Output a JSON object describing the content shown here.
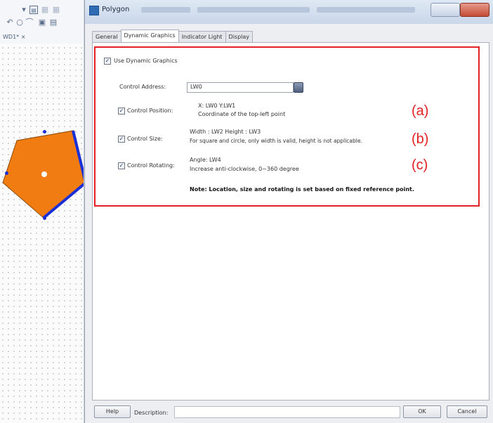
{
  "dialog": {
    "title": "Polygon",
    "tabs": [
      "General",
      "Dynamic Graphics",
      "Indicator Light",
      "Display"
    ],
    "active_tab": "Dynamic Graphics"
  },
  "editor": {
    "tab_label": "WD1* ×",
    "shape_fill": "#f07c12",
    "shape_edge": "#1a2fd6"
  },
  "dynamic": {
    "use_label": "Use Dynamic Graphics",
    "use_checked": true,
    "control_address_label": "Control Address:",
    "control_address_value": "LW0",
    "position": {
      "label": "Control Position:",
      "checked": true,
      "line1": "X: LW0   Y:LW1",
      "line2": "Coordinate of the top-left point"
    },
    "size": {
      "label": "Control Size:",
      "checked": true,
      "line1": "Width : LW2   Height : LW3",
      "line2": "For square and circle, only width is valid, height is not applicable."
    },
    "rotating": {
      "label": "Control Rotating:",
      "checked": true,
      "line1": "Angle: LW4",
      "line2": "Increase anti-clockwise, 0~360 degree"
    },
    "note": "Note: Location, size and rotating is set based on fixed reference point."
  },
  "annotations": {
    "a": "(a)",
    "b": "(b)",
    "c": "(c)",
    "color": "#e32024"
  },
  "footer": {
    "help_label": "Help",
    "description_label": "Description:",
    "description_value": "",
    "ok_label": "OK",
    "cancel_label": "Cancel"
  }
}
